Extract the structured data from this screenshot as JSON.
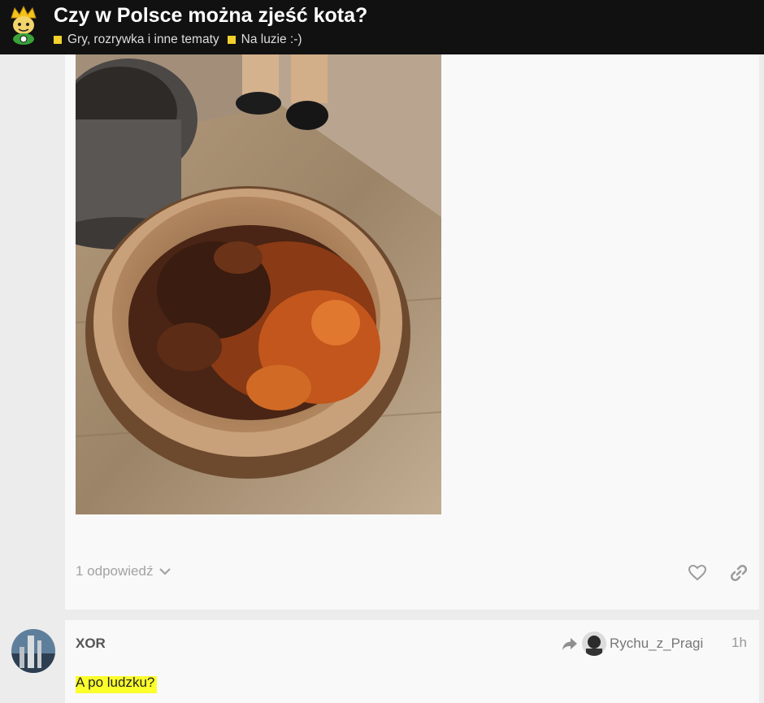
{
  "header": {
    "title": "Czy w Polsce można zjeść kota?",
    "categories": [
      {
        "label": "Gry, rozrywka i inne tematy",
        "color": "#f1d12b"
      },
      {
        "label": "Na luzie :-)",
        "color": "#f1d12b"
      }
    ],
    "logo_icon": "crowned-mascot-logo"
  },
  "post1": {
    "image_icon": "cockroaches-in-coconut-bowl-photo",
    "replies_label": "1 odpowiedź",
    "like_icon": "heart-icon",
    "share_icon": "link-icon"
  },
  "post2": {
    "author": "XOR",
    "reply_to_user": "Rychu_z_Pragi",
    "time": "1h",
    "body": "A po ludzku?",
    "highlight_color": "#fbff2b"
  }
}
